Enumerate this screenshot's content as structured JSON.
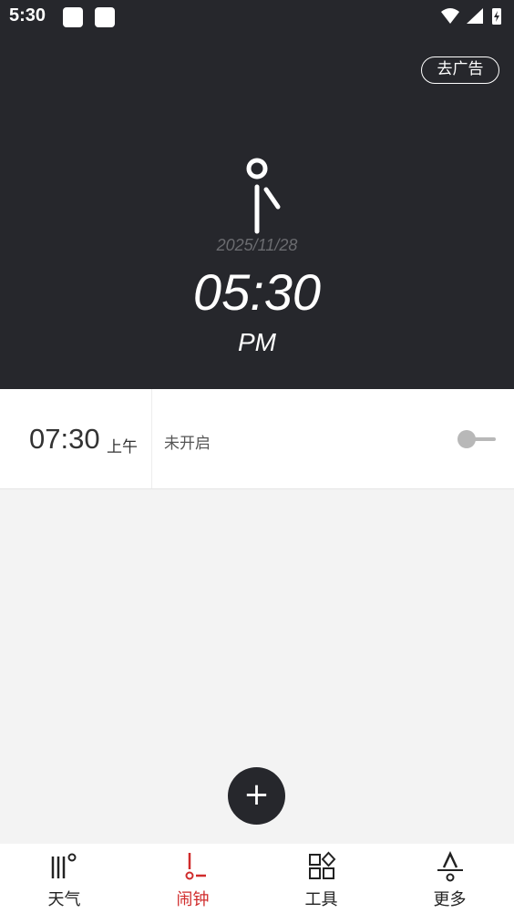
{
  "status_bar": {
    "time": "5:30"
  },
  "header": {
    "ad_button": "去广告",
    "date": "2025/11/28",
    "time": "05:30",
    "ampm": "PM"
  },
  "alarms": [
    {
      "time": "07:30",
      "period": "上午",
      "status": "未开启",
      "enabled": false
    }
  ],
  "fab": {
    "icon": "plus-icon",
    "label": "+"
  },
  "nav": {
    "items": [
      {
        "label": "天气",
        "icon": "weather-icon",
        "active": false
      },
      {
        "label": "闹钟",
        "icon": "alarm-icon",
        "active": true
      },
      {
        "label": "工具",
        "icon": "tools-grid-icon",
        "active": false
      },
      {
        "label": "更多",
        "icon": "more-icon",
        "active": false
      }
    ],
    "active_color": "#d02c2c"
  },
  "colors": {
    "header_bg": "#26272c",
    "accent": "#d02c2c"
  }
}
